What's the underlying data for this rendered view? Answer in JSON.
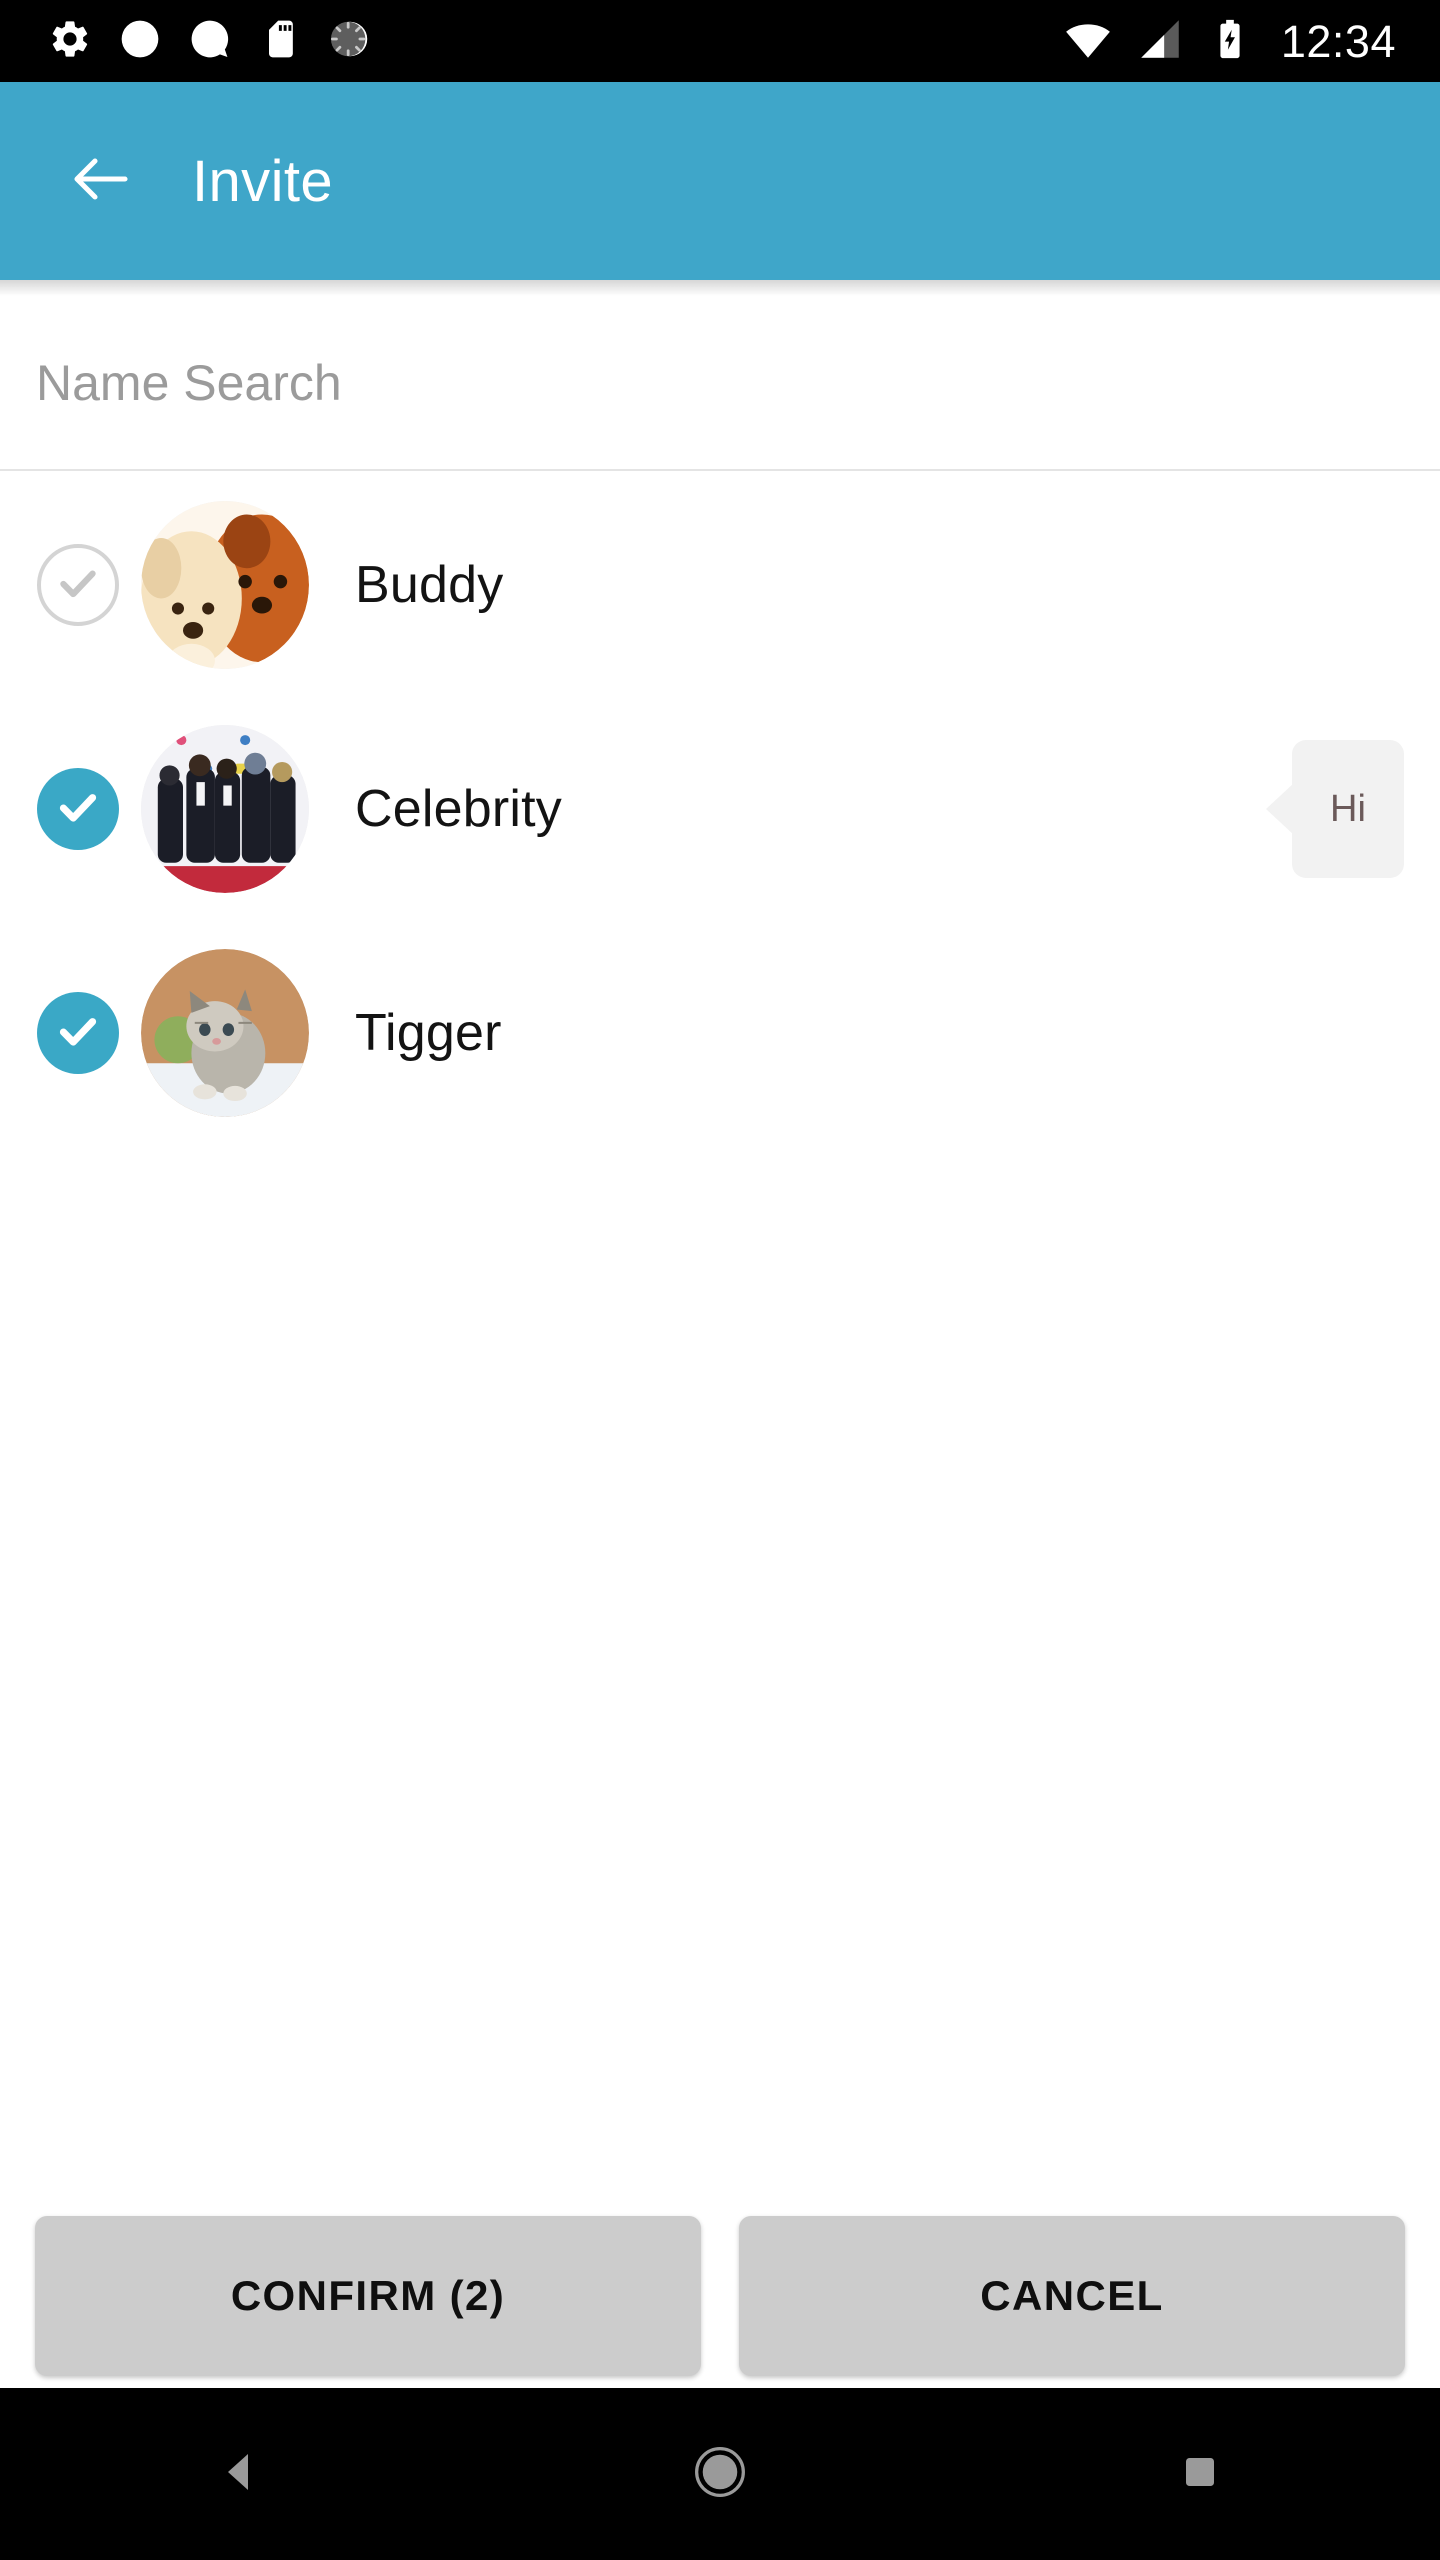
{
  "statusbar": {
    "time": "12:34",
    "left_icons": [
      "gear-icon",
      "circle-icon",
      "speech-bubble-icon",
      "sd-card-icon",
      "sync-spinner-icon"
    ],
    "right_icons": [
      "wifi-icon",
      "cell-signal-icon",
      "battery-charging-icon"
    ]
  },
  "appbar": {
    "back_icon": "arrow-left-icon",
    "title": "Invite",
    "background": "#3fa6c9"
  },
  "search": {
    "value": "",
    "placeholder": "Name Search"
  },
  "list": {
    "rows": [
      {
        "name": "Buddy",
        "selected": false,
        "avatar": "two-puppies",
        "badge": ""
      },
      {
        "name": "Celebrity",
        "selected": true,
        "avatar": "boy-band",
        "badge": "Hi"
      },
      {
        "name": "Tigger",
        "selected": true,
        "avatar": "grey-kitten",
        "badge": ""
      }
    ],
    "checked_color": "#3aa8c6",
    "unchecked_color": "#d4d4d4"
  },
  "footer": {
    "confirm_label": "CONFIRM (2)",
    "cancel_label": "CANCEL",
    "selected_count": 2
  },
  "navbar": {
    "back_label": "back-triangle-icon",
    "home_label": "home-circle-icon",
    "recents_label": "recents-square-icon"
  }
}
